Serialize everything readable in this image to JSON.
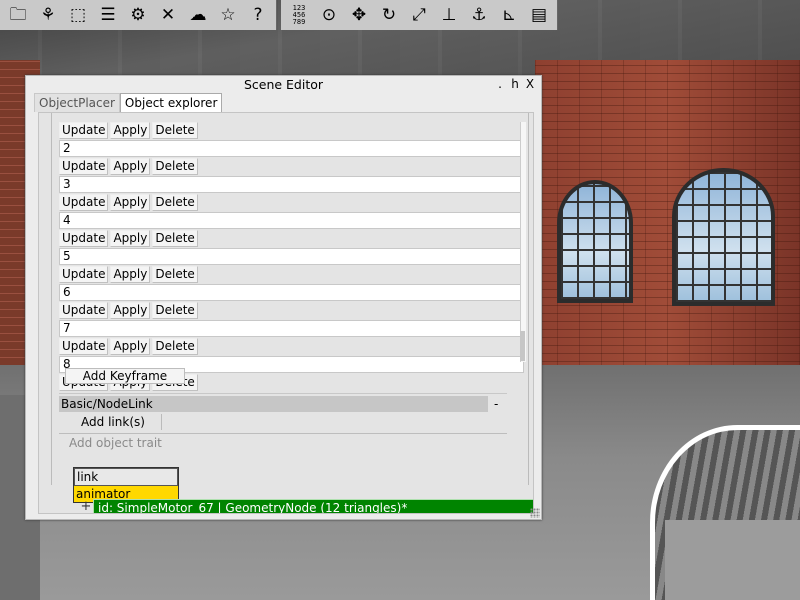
{
  "toolbar": {
    "group1": [
      {
        "icon": "folder-icon",
        "glyph": "🗀"
      },
      {
        "icon": "tree-build-icon",
        "glyph": "⚘"
      },
      {
        "icon": "puzzle-icon",
        "glyph": "⬚"
      },
      {
        "icon": "list-icon",
        "glyph": "☰"
      },
      {
        "icon": "gear-icon",
        "glyph": "⚙"
      },
      {
        "icon": "tools-icon",
        "glyph": "✕"
      },
      {
        "icon": "weather-icon",
        "glyph": "☁"
      },
      {
        "icon": "star-icon",
        "glyph": "☆"
      },
      {
        "icon": "help-icon",
        "glyph": "?"
      }
    ],
    "group2": [
      {
        "icon": "numbers-icon",
        "glyph": "123\n456\n789"
      },
      {
        "icon": "camera-icon",
        "glyph": "⊙"
      },
      {
        "icon": "move-icon",
        "glyph": "✥"
      },
      {
        "icon": "rotate-icon",
        "glyph": "↻"
      },
      {
        "icon": "scale-icon",
        "glyph": "⤢"
      },
      {
        "icon": "vertical-align-icon",
        "glyph": "⊥"
      },
      {
        "icon": "anchor-icon",
        "glyph": "⚓"
      },
      {
        "icon": "measure-icon",
        "glyph": "⊾"
      },
      {
        "icon": "document-icon",
        "glyph": "▤"
      }
    ]
  },
  "editor": {
    "title": "Scene Editor",
    "title_buttons": [
      ".",
      "h",
      "X"
    ],
    "tabs": [
      "ObjectPlacer",
      "Object explorer"
    ],
    "keyframe_buttons": {
      "update": "Update",
      "apply": "Apply",
      "delete": "Delete"
    },
    "keyframes": [
      "2",
      "3",
      "4",
      "5",
      "6",
      "7",
      "8"
    ],
    "add_keyframe": "Add Keyframe",
    "section_header": "Basic/NodeLink",
    "section_collapse": "-",
    "add_links": "Add link(s)",
    "add_trait_placeholder": "Add object trait",
    "dropdown_options": [
      "link",
      "animator"
    ],
    "expand": "+",
    "node_label": "id: SimpleMotor_67 | GeometryNode (12 triangles)*"
  }
}
